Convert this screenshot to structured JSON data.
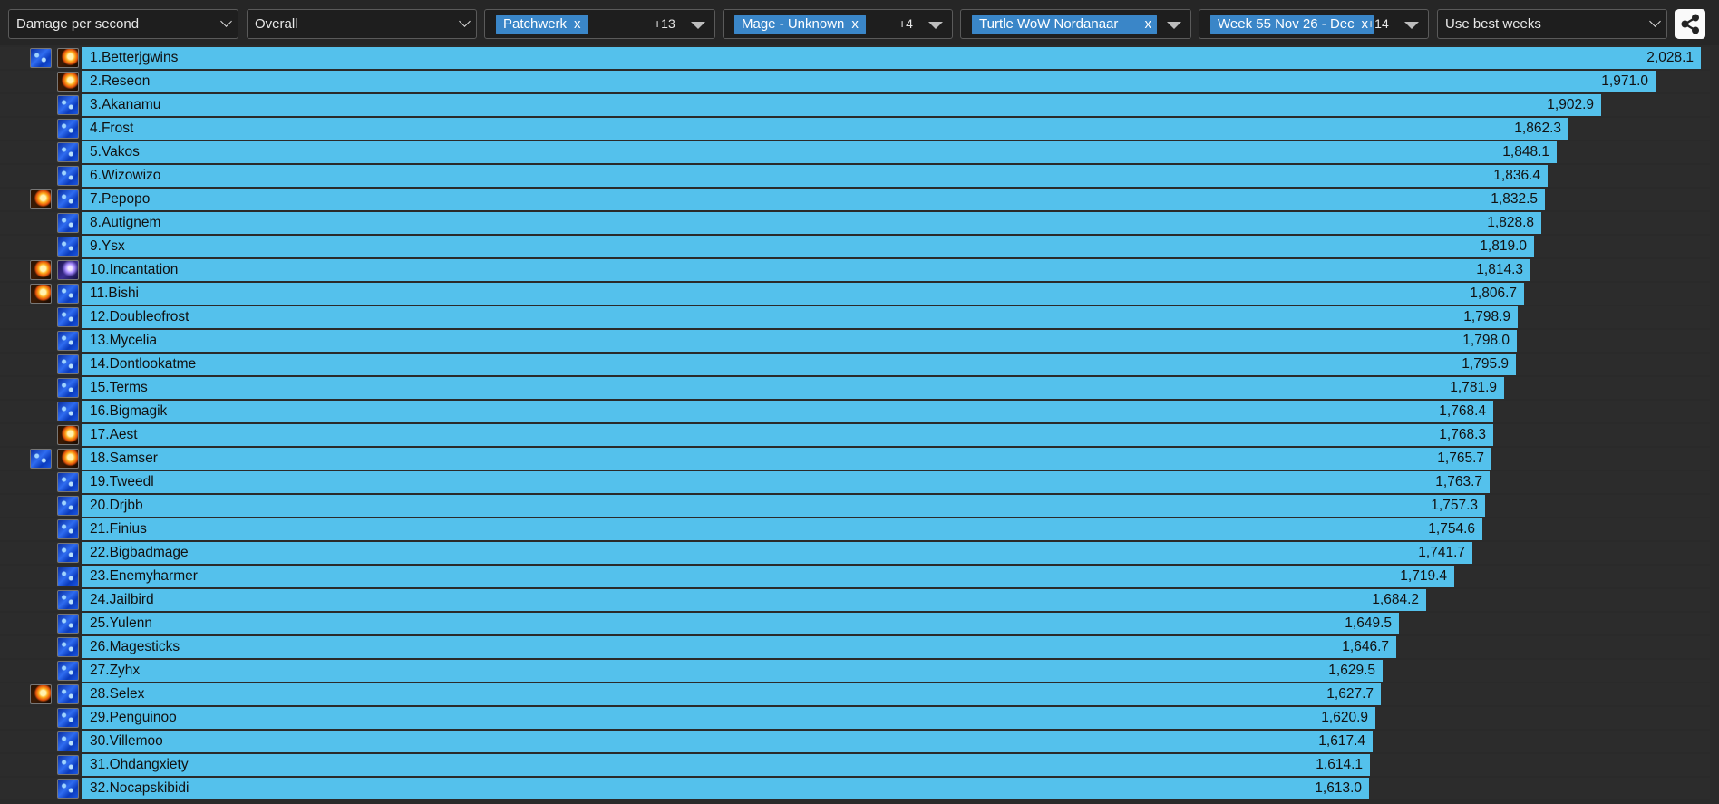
{
  "filters": {
    "metric": "Damage per second",
    "period": "Overall",
    "boss": {
      "chip": "Patchwerk",
      "more": "+13"
    },
    "spec": {
      "chip": "Mage - Unknown",
      "more": "+4"
    },
    "realm": {
      "chip": "Turtle WoW Nordanaar"
    },
    "week": {
      "chip": "Week 55 Nov 26 - Dec",
      "more": "+14"
    },
    "mode": "Use best weeks",
    "chip_close": "x"
  },
  "share_icon": "share-icon",
  "colors": {
    "bar": "#54c1ec",
    "chip": "#3a86c8",
    "background": "#2a2a2a"
  },
  "max_value": 2028.1,
  "rankings": [
    {
      "rank": "1.",
      "name": "Betterjgwins",
      "value": 2028.1,
      "value_text": "2,028.1",
      "icons": [
        "frost",
        "fire"
      ]
    },
    {
      "rank": "2.",
      "name": "Reseon",
      "value": 1971.0,
      "value_text": "1,971.0",
      "icons": [
        "",
        "fire"
      ]
    },
    {
      "rank": "3.",
      "name": "Akanamu",
      "value": 1902.9,
      "value_text": "1,902.9",
      "icons": [
        "",
        "frost"
      ]
    },
    {
      "rank": "4.",
      "name": "Frost",
      "value": 1862.3,
      "value_text": "1,862.3",
      "icons": [
        "",
        "frost"
      ]
    },
    {
      "rank": "5.",
      "name": "Vakos",
      "value": 1848.1,
      "value_text": "1,848.1",
      "icons": [
        "",
        "frost"
      ]
    },
    {
      "rank": "6.",
      "name": "Wizowizo",
      "value": 1836.4,
      "value_text": "1,836.4",
      "icons": [
        "",
        "frost"
      ]
    },
    {
      "rank": "7.",
      "name": "Pepopo",
      "value": 1832.5,
      "value_text": "1,832.5",
      "icons": [
        "fire",
        "frost"
      ]
    },
    {
      "rank": "8.",
      "name": "Autignem",
      "value": 1828.8,
      "value_text": "1,828.8",
      "icons": [
        "",
        "frost"
      ]
    },
    {
      "rank": "9.",
      "name": "Ysx",
      "value": 1819.0,
      "value_text": "1,819.0",
      "icons": [
        "",
        "frost"
      ]
    },
    {
      "rank": "10.",
      "name": "Incantation",
      "value": 1814.3,
      "value_text": "1,814.3",
      "icons": [
        "fire",
        "arcane"
      ]
    },
    {
      "rank": "11.",
      "name": "Bishi",
      "value": 1806.7,
      "value_text": "1,806.7",
      "icons": [
        "fire",
        "frost"
      ]
    },
    {
      "rank": "12.",
      "name": "Doubleofrost",
      "value": 1798.9,
      "value_text": "1,798.9",
      "icons": [
        "",
        "frost"
      ]
    },
    {
      "rank": "13.",
      "name": "Mycelia",
      "value": 1798.0,
      "value_text": "1,798.0",
      "icons": [
        "",
        "frost"
      ]
    },
    {
      "rank": "14.",
      "name": "Dontlookatme",
      "value": 1795.9,
      "value_text": "1,795.9",
      "icons": [
        "",
        "frost"
      ]
    },
    {
      "rank": "15.",
      "name": "Terms",
      "value": 1781.9,
      "value_text": "1,781.9",
      "icons": [
        "",
        "frost"
      ]
    },
    {
      "rank": "16.",
      "name": "Bigmagik",
      "value": 1768.4,
      "value_text": "1,768.4",
      "icons": [
        "",
        "frost"
      ]
    },
    {
      "rank": "17.",
      "name": "Aest",
      "value": 1768.3,
      "value_text": "1,768.3",
      "icons": [
        "",
        "fire"
      ]
    },
    {
      "rank": "18.",
      "name": "Samser",
      "value": 1765.7,
      "value_text": "1,765.7",
      "icons": [
        "frost",
        "fire"
      ]
    },
    {
      "rank": "19.",
      "name": "Tweedl",
      "value": 1763.7,
      "value_text": "1,763.7",
      "icons": [
        "",
        "frost"
      ]
    },
    {
      "rank": "20.",
      "name": "Drjbb",
      "value": 1757.3,
      "value_text": "1,757.3",
      "icons": [
        "",
        "frost"
      ]
    },
    {
      "rank": "21.",
      "name": "Finius",
      "value": 1754.6,
      "value_text": "1,754.6",
      "icons": [
        "",
        "frost"
      ]
    },
    {
      "rank": "22.",
      "name": "Bigbadmage",
      "value": 1741.7,
      "value_text": "1,741.7",
      "icons": [
        "",
        "frost"
      ]
    },
    {
      "rank": "23.",
      "name": "Enemyharmer",
      "value": 1719.4,
      "value_text": "1,719.4",
      "icons": [
        "",
        "frost"
      ]
    },
    {
      "rank": "24.",
      "name": "Jailbird",
      "value": 1684.2,
      "value_text": "1,684.2",
      "icons": [
        "",
        "frost"
      ]
    },
    {
      "rank": "25.",
      "name": "Yulenn",
      "value": 1649.5,
      "value_text": "1,649.5",
      "icons": [
        "",
        "frost"
      ]
    },
    {
      "rank": "26.",
      "name": "Magesticks",
      "value": 1646.7,
      "value_text": "1,646.7",
      "icons": [
        "",
        "frost"
      ]
    },
    {
      "rank": "27.",
      "name": "Zyhx",
      "value": 1629.5,
      "value_text": "1,629.5",
      "icons": [
        "",
        "frost"
      ]
    },
    {
      "rank": "28.",
      "name": "Selex",
      "value": 1627.7,
      "value_text": "1,627.7",
      "icons": [
        "fire",
        "frost"
      ]
    },
    {
      "rank": "29.",
      "name": "Penguinoo",
      "value": 1620.9,
      "value_text": "1,620.9",
      "icons": [
        "",
        "frost"
      ]
    },
    {
      "rank": "30.",
      "name": "Villemoo",
      "value": 1617.4,
      "value_text": "1,617.4",
      "icons": [
        "",
        "frost"
      ]
    },
    {
      "rank": "31.",
      "name": "Ohdangxiety",
      "value": 1614.1,
      "value_text": "1,614.1",
      "icons": [
        "",
        "frost"
      ]
    },
    {
      "rank": "32.",
      "name": "Nocapskibidi",
      "value": 1613.0,
      "value_text": "1,613.0",
      "icons": [
        "",
        "frost"
      ]
    }
  ]
}
